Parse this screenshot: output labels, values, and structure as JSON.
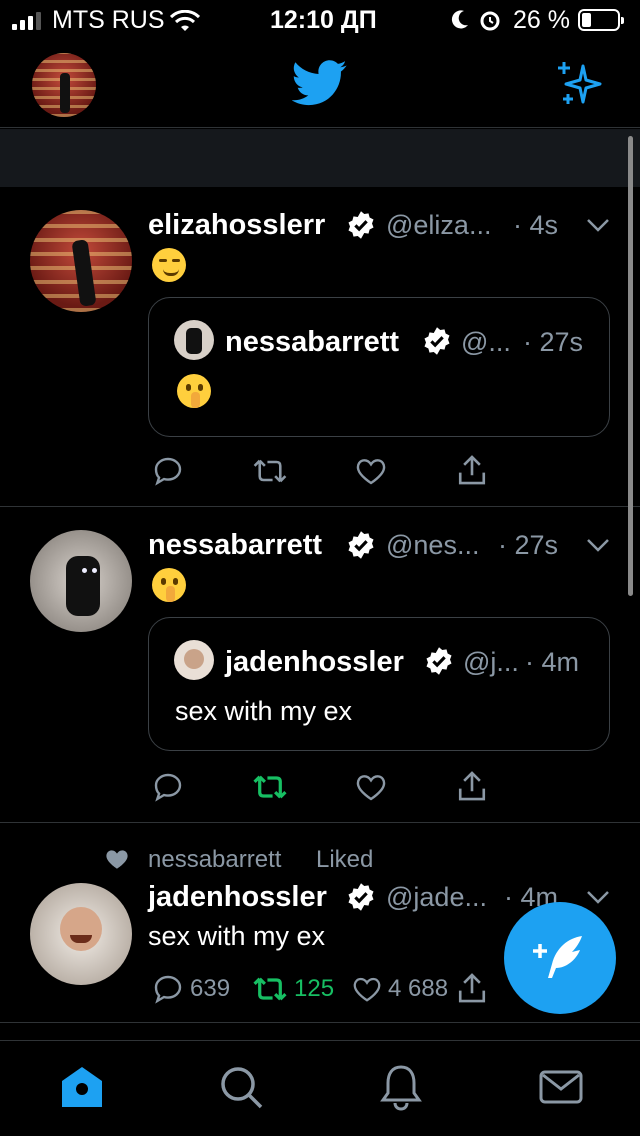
{
  "status_bar": {
    "carrier": "MTS RUS",
    "time": "12:10 ДП",
    "battery_percent": "26 %",
    "battery_level": 0.26
  },
  "nav": {
    "logo_icon": "twitter-bird-icon",
    "sparkle_icon": "sparkle-icon"
  },
  "colors": {
    "accent": "#1da1f2",
    "retweet_green": "#17bf63",
    "background": "#000000",
    "secondary_text": "#8b98a5",
    "divider": "#2f3336"
  },
  "tweets": [
    {
      "name": "elizahosslerr",
      "handle": "@eliza...",
      "time": "· 4s",
      "emoji": "smirking-face",
      "quote": {
        "name": "nessabarrett",
        "handle": "@...",
        "time": "· 27s",
        "emoji": "shushing-face"
      }
    },
    {
      "name": "nessabarrett",
      "handle": "@nes...",
      "time": "· 27s",
      "emoji": "shushing-face",
      "retweeted": true,
      "quote": {
        "name": "jadenhossler",
        "handle": "@j...",
        "time": "· 4m",
        "text": "sex with my ex"
      }
    },
    {
      "social_context_name": "nessabarrett",
      "social_context_action": "Liked",
      "name": "jadenhossler",
      "handle": "@jade...",
      "time": "· 4m",
      "text": "sex with my ex",
      "replies": "639",
      "retweets": "125",
      "likes": "4 688"
    }
  ],
  "tabs": [
    "home-icon",
    "search-icon",
    "notifications-bell-icon",
    "messages-mail-icon"
  ]
}
